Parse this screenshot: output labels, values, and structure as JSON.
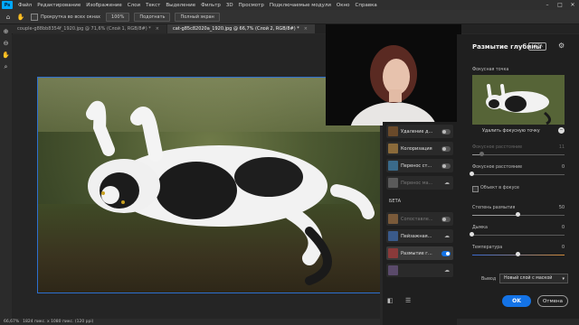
{
  "menubar": {
    "logo": "Ps",
    "items": [
      "Файл",
      "Редактирование",
      "Изображение",
      "Слои",
      "Текст",
      "Выделение",
      "Фильтр",
      "3D",
      "Просмотр",
      "Подключаемые модули",
      "Окно",
      "Справка"
    ],
    "window_controls": [
      "–",
      "□",
      "✕"
    ]
  },
  "optbar": {
    "scroll_all_label": "Прокрутка во всех окнах",
    "zoom_value": "100%",
    "fit_label": "Подогнать",
    "fullscreen_label": "Полный экран"
  },
  "tabs": [
    {
      "label": "couple-g88bb8354f_1920.jpg @ 71,6% (Слой 1, RGB/8#) *",
      "active": false
    },
    {
      "label": "cat-g85c82020a_1920.jpg @ 66,7% (Слой 2, RGB/8#) *",
      "active": true
    }
  ],
  "status": {
    "zoom": "66,67%",
    "doc_info": "1824 пикс. x 1080 пикс. (120 ppi)"
  },
  "neural_list": {
    "items": [
      {
        "label": "Удаление д...",
        "state": "toggle_off",
        "dim": false,
        "thumb": "#6a4a2a"
      },
      {
        "label": "Колоризация",
        "state": "toggle_off",
        "dim": false,
        "thumb": "#8a6a3a"
      },
      {
        "label": "Перенос ст...",
        "state": "toggle_off",
        "dim": false,
        "thumb": "#3a6a8a"
      },
      {
        "label": "Перенос ма...",
        "state": "cloud",
        "dim": true,
        "thumb": "#5a5a5a"
      }
    ],
    "beta_heading": "БЕТА",
    "beta_items": [
      {
        "label": "Сопоставле...",
        "state": "toggle_off",
        "dim": true,
        "thumb": "#7a5a3a"
      },
      {
        "label": "Пейзажная...",
        "state": "cloud",
        "dim": false,
        "thumb": "#3a5a8a"
      },
      {
        "label": "Размытие г...",
        "state": "toggle_on",
        "dim": false,
        "selected": true,
        "thumb": "#8a3a3a"
      },
      {
        "label": "",
        "state": "cloud",
        "dim": false,
        "thumb": "#5a4a6a"
      }
    ]
  },
  "panel": {
    "title": "Размытие глубины",
    "badge": "БЕТА",
    "focal_point_label": "Фокусная точка",
    "remove_focal_label": "Удалить фокусную точку",
    "focal_distance_dim": {
      "label": "Фокусное расстояние",
      "value": "11",
      "level": 0.11
    },
    "focal_range": {
      "label": "Фокусное расстояние",
      "value": "0",
      "level": 0.0
    },
    "subject_focus_label": "Объект в фокусе",
    "blur_strength": {
      "label": "Степень размытия",
      "value": "50",
      "level": 0.5
    },
    "haze": {
      "label": "Дымка",
      "value": "0",
      "level": 0.0
    },
    "temperature": {
      "label": "Температура",
      "value": "0",
      "level": 0.5
    },
    "output_label": "Вывод",
    "output_value": "Новый слой с маской",
    "ok_label": "OK",
    "cancel_label": "Отмена"
  },
  "colors": {
    "accent": "#1473e6",
    "selection_border": "#2d6fd0"
  }
}
